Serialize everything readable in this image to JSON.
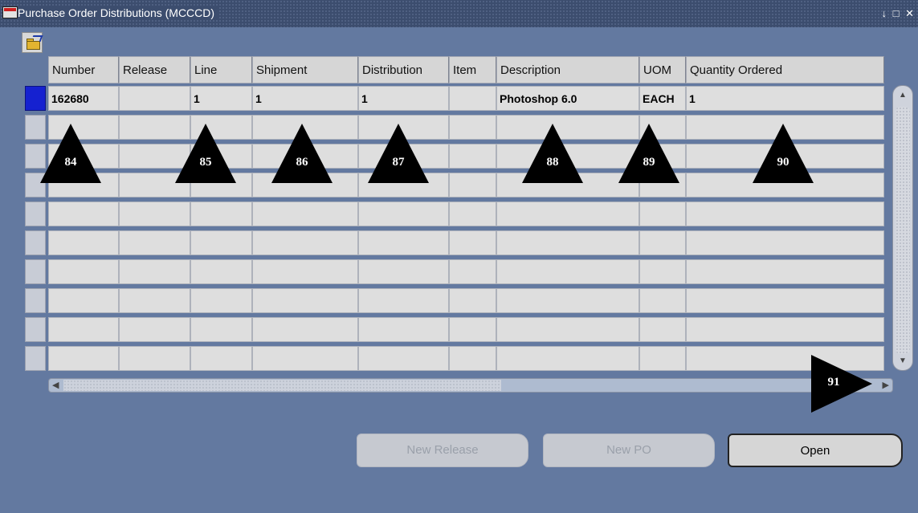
{
  "window": {
    "title": "Purchase Order Distributions (MCCCD)",
    "controls": [
      "minimize-icon",
      "maximize-icon",
      "close-icon"
    ]
  },
  "toolbar": {
    "open_icon": "open-folder-icon"
  },
  "table": {
    "columns": [
      "Number",
      "Release",
      "Line",
      "Shipment",
      "Distribution",
      "Item",
      "Description",
      "UOM",
      "Quantity Ordered"
    ],
    "rows": [
      [
        "162680",
        "",
        "1",
        "1",
        "1",
        "",
        "Photoshop 6.0",
        "EACH",
        "1"
      ],
      [
        "",
        "",
        "",
        "",
        "",
        "",
        "",
        "",
        ""
      ],
      [
        "",
        "",
        "",
        "",
        "",
        "",
        "",
        "",
        ""
      ],
      [
        "",
        "",
        "",
        "",
        "",
        "",
        "",
        "",
        ""
      ],
      [
        "",
        "",
        "",
        "",
        "",
        "",
        "",
        "",
        ""
      ],
      [
        "",
        "",
        "",
        "",
        "",
        "",
        "",
        "",
        ""
      ],
      [
        "",
        "",
        "",
        "",
        "",
        "",
        "",
        "",
        ""
      ],
      [
        "",
        "",
        "",
        "",
        "",
        "",
        "",
        "",
        ""
      ],
      [
        "",
        "",
        "",
        "",
        "",
        "",
        "",
        "",
        ""
      ],
      [
        "",
        "",
        "",
        "",
        "",
        "",
        "",
        "",
        ""
      ]
    ],
    "selected_row": 0,
    "selected_row_color": "#1521d0"
  },
  "buttons": {
    "new_release": "New Release",
    "new_po": "New PO",
    "open": "Open"
  },
  "callouts": [
    "84",
    "85",
    "86",
    "87",
    "88",
    "89",
    "90",
    "91"
  ],
  "colors": {
    "background": "#6379a0",
    "titlebar": "#3c4d6e",
    "callout": "#000000"
  }
}
